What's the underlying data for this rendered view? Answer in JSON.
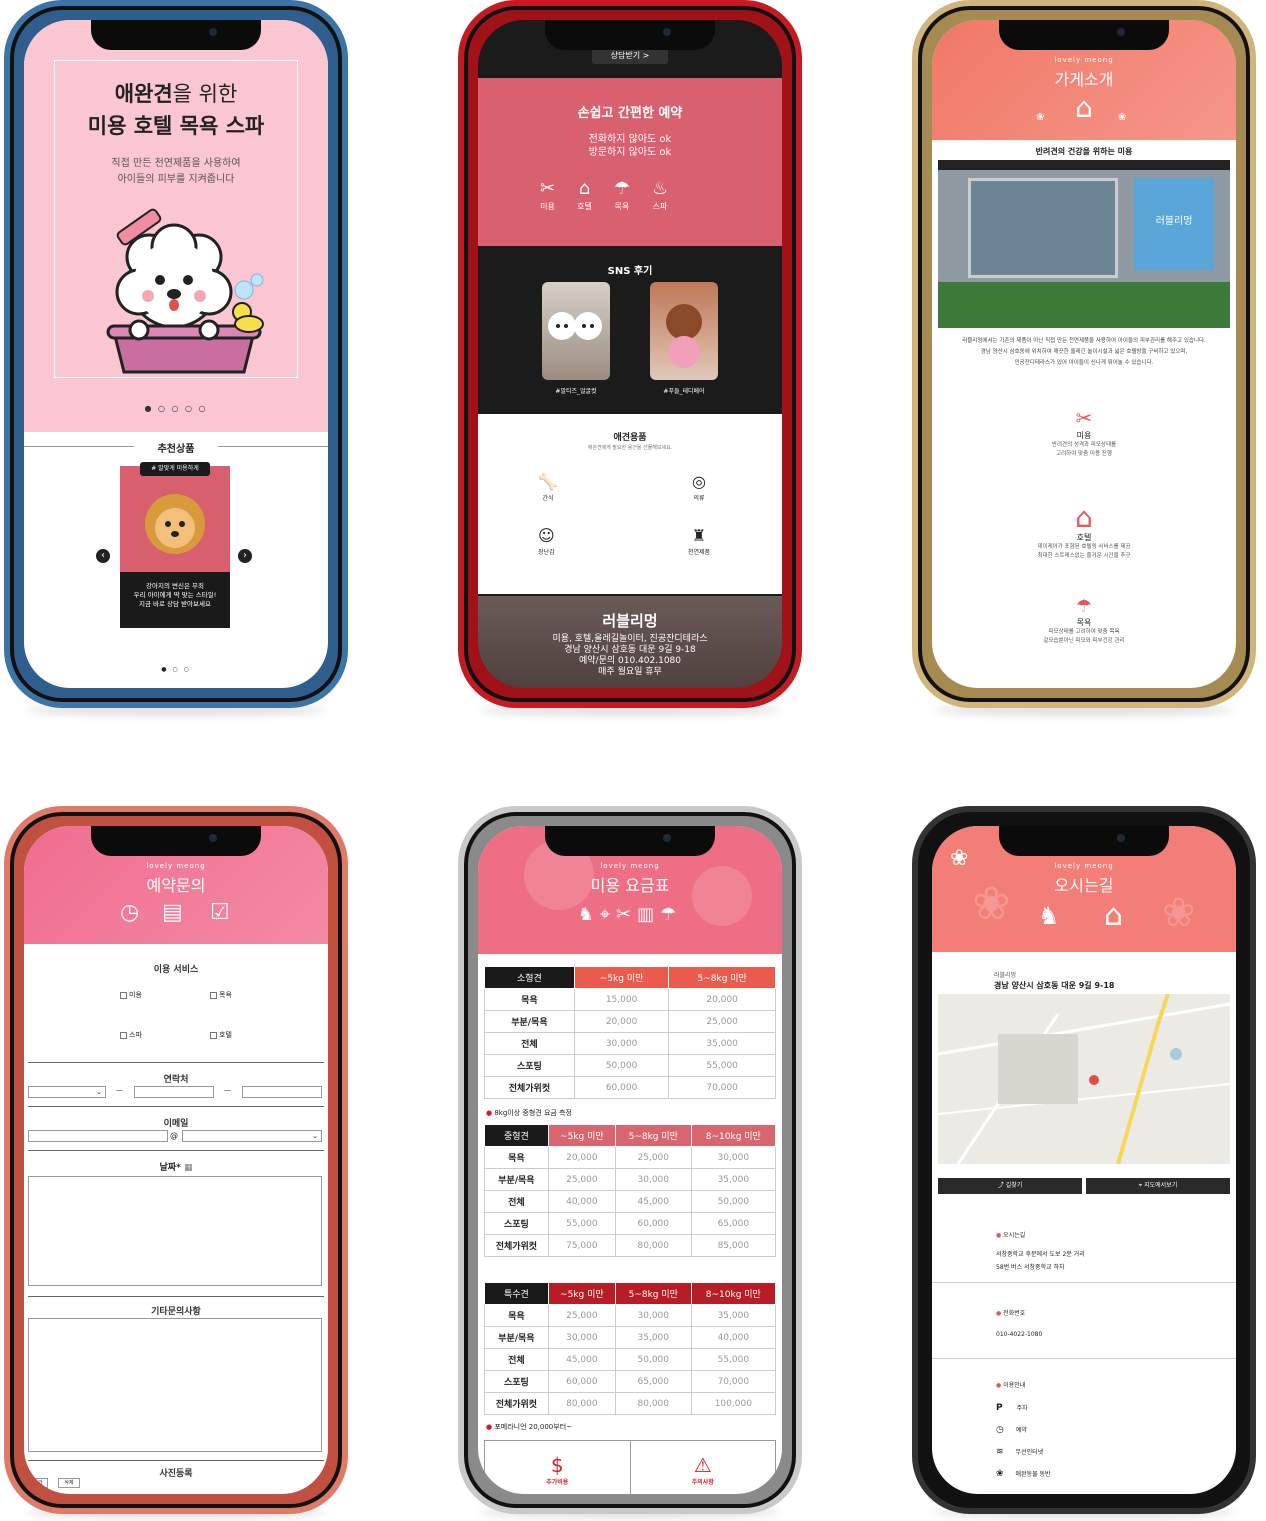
{
  "p1": {
    "headline_bold": "애완견",
    "headline_rest": "을 위한",
    "headline2": "미용 호텔 목욕 스파",
    "sub1": "직접 만든 천연제품을 사용하여",
    "sub2": "아이들의 피부를 지켜줍니다",
    "rec_title": "추천상품",
    "tag": "# 말맞게 미용하게",
    "desc1": "강아지의 변신은 무죄",
    "desc2": "우리 아이에게 딱 맞는 스타일!",
    "desc3": "지금 바로 상담 받아보세요",
    "prev": "‹",
    "next": "›"
  },
  "p2": {
    "consult": "상담받기 >",
    "reserve_title": "손쉽고 간편한 예약",
    "reserve_l1": "전화하지 않아도 ok",
    "reserve_l2": "방문하지 않아도 ok",
    "services": [
      "미용",
      "호텔",
      "목욕",
      "스파"
    ],
    "sns_title": "SNS 후기",
    "sns_tags": [
      "#말티즈_얼굴컷",
      "#푸들_테디베어"
    ],
    "goods_title": "애견용품",
    "goods_sub": "애완견에게 필요한 용건을 선물해보세요.",
    "goods": [
      "간식",
      "의류",
      "장난감",
      "천연제품"
    ],
    "shop_name": "러블리멍",
    "shop_l1": "미용, 호텔,올레길놀이터, 진공잔디테라스",
    "shop_l2": "경남 양산시 삼호동 대운 9길 9-18",
    "shop_l3": "예약/문의 010.402.1080",
    "shop_l4": "매주 월요일 휴무"
  },
  "p3": {
    "eyebrow": "lovely meong",
    "title": "가게소개",
    "caption": "반려견의 건강을 위하는 미용",
    "store_sign": "러블리멍",
    "body1": "러블리멍에서는 기존의 제품이 아닌 직접 만든 천연제품을 사용하여 아이들의 피부관리를 해주고 있습니다.",
    "body2": "경남 양산시 삼호동에 위치하여 깨끗한 올레긴 놀이시설과 넓은 호텔방을 구비하고 있으며,",
    "body3": "인공잔디테라스가 있어 아이들이 신나게 뛰어놀 수 있습니다.",
    "features": [
      {
        "name": "미용",
        "l1": "반려견의 성격과 피모상태를",
        "l2": "고려하여 맞춤 미용 진행"
      },
      {
        "name": "호텔",
        "l1": "데이케어가 포함된 호텔링 서비스를 제공",
        "l2": "최대한 스트레스없는 즐거운 시간을 추구"
      },
      {
        "name": "목욕",
        "l1": "피모상태를 고려하여 맞춤 목욕",
        "l2": "겉모습뿐아닌 피모와 피부건강 관리"
      }
    ]
  },
  "p4": {
    "eyebrow": "lovely meong",
    "title": "예약문의",
    "service_label": "이용 서비스",
    "opts": [
      "미용",
      "목욕",
      "스파",
      "호텔"
    ],
    "contact_label": "연락처",
    "email_label": "이메일",
    "at": "@",
    "dash": "—",
    "date_label": "날짜*",
    "etc_label": "기타문의사항",
    "photo_label": "사진등록",
    "btn_a": "추가",
    "btn_b": "삭제"
  },
  "p5": {
    "eyebrow": "lovely meong",
    "title": "미용 요금표",
    "small": {
      "head": [
        "소형견",
        "~5kg 미만",
        "5~8kg 미만"
      ],
      "rows": [
        [
          "목욕",
          "15,000",
          "20,000"
        ],
        [
          "부분/목욕",
          "20,000",
          "25,000"
        ],
        [
          "전체",
          "30,000",
          "35,000"
        ],
        [
          "스포팅",
          "50,000",
          "55,000"
        ],
        [
          "전체가위컷",
          "60,000",
          "70,000"
        ]
      ]
    },
    "note1": "8kg이상 중형견 요금 측정",
    "medium": {
      "head": [
        "중형견",
        "~5kg 미만",
        "5~8kg 미만",
        "8~10kg 미만"
      ],
      "rows": [
        [
          "목욕",
          "20,000",
          "25,000",
          "30,000"
        ],
        [
          "부분/목욕",
          "25,000",
          "30,000",
          "35,000"
        ],
        [
          "전체",
          "40,000",
          "45,000",
          "50,000"
        ],
        [
          "스포팅",
          "55,000",
          "60,000",
          "65,000"
        ],
        [
          "전체가위컷",
          "75,000",
          "80,000",
          "85,000"
        ]
      ]
    },
    "special": {
      "head": [
        "특수견",
        "~5kg 미만",
        "5~8kg 미만",
        "8~10kg 미만"
      ],
      "rows": [
        [
          "목욕",
          "25,000",
          "30,000",
          "35,000"
        ],
        [
          "부분/목욕",
          "30,000",
          "35,000",
          "40,000"
        ],
        [
          "전체",
          "45,000",
          "50,000",
          "55,000"
        ],
        [
          "스포팅",
          "60,000",
          "65,000",
          "70,000"
        ],
        [
          "전체가위컷",
          "80,000",
          "80,000",
          "100,000"
        ]
      ]
    },
    "note2": "포메라니언 20,000부터~",
    "extra": "추가비용",
    "caution": "주의사항",
    "colors": {
      "small": "#ea5a4d",
      "medium": "#d8666f",
      "special": "#b81d26"
    }
  },
  "p6": {
    "eyebrow": "lovely meong",
    "title": "오시는길",
    "shop": "러블리멍",
    "address": "경남 양산시 삼호동 대운 9길 9-18",
    "btn_route": "길찾기",
    "btn_map": "지도에서보기",
    "way_title": "오시는길",
    "way1": "서창중학교 후문에서 도보 2분 거리",
    "way2": "58번 버스 서창중학교 하차",
    "tel_title": "전화번호",
    "tel": "010-4022-1080",
    "info_title": "이용안내",
    "info": [
      "주차",
      "예약",
      "무선인터넷",
      "애완동물 동반"
    ]
  }
}
